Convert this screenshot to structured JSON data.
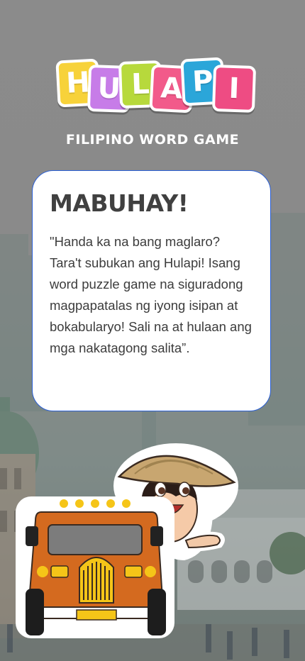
{
  "logo": {
    "letters": [
      "H",
      "U",
      "L",
      "A",
      "P",
      "I"
    ],
    "colors": [
      "#f7d23a",
      "#c77ce8",
      "#b7d93c",
      "#f25a8a",
      "#2ba6d9",
      "#ee4c83"
    ]
  },
  "header": {
    "subtitle": "FILIPINO WORD GAME"
  },
  "card": {
    "title": "MABUHAY!",
    "body": "\"Handa ka na bang maglaro? Tara't subukan ang Hulapi! Isang word puzzle game na siguradong magpapatalas ng iyong isipan at bokabularyo! Sali na at hulaan ang mga nakatagong salita”."
  },
  "illustration": {
    "character": "farmer-boy-salakot",
    "vehicle": "jeepney",
    "background": "city-plaza-scene"
  }
}
